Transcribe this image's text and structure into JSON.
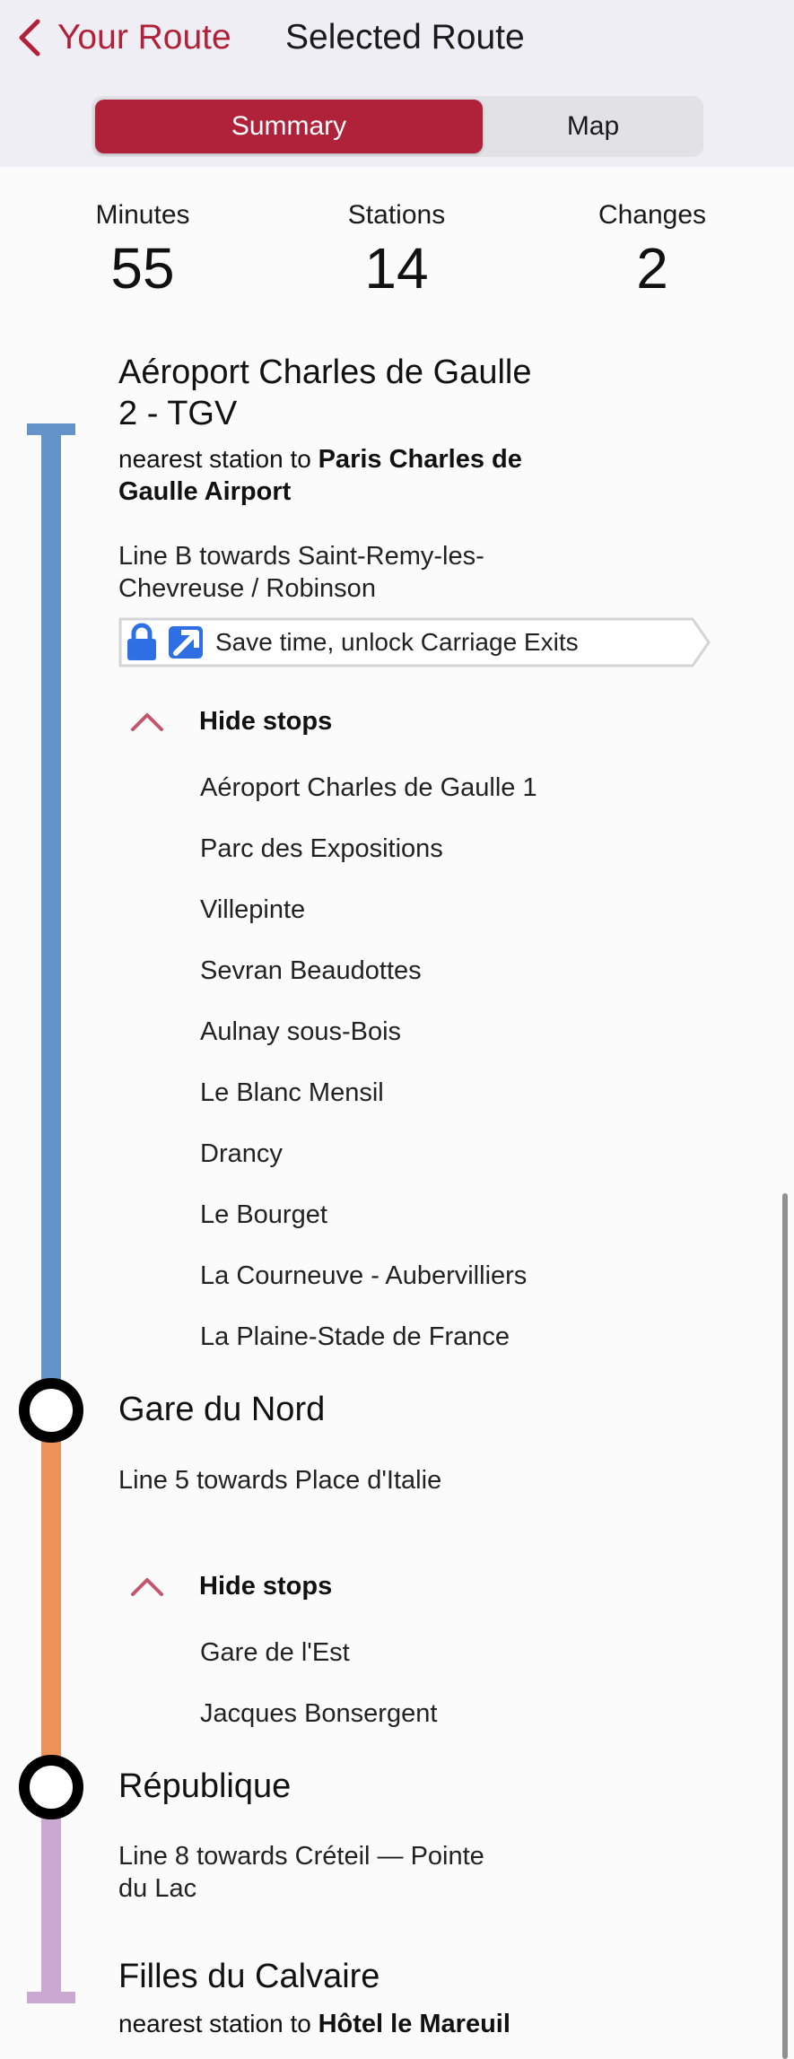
{
  "nav": {
    "back_label": "Your Route",
    "title": "Selected Route"
  },
  "tabs": {
    "summary": "Summary",
    "map": "Map",
    "selected": "Summary"
  },
  "stats": [
    {
      "label": "Minutes",
      "value": "55"
    },
    {
      "label": "Stations",
      "value": "14"
    },
    {
      "label": "Changes",
      "value": "2"
    }
  ],
  "colors": {
    "accent": "#b0213a",
    "line_b": "#6393c9",
    "line_5": "#ea9258",
    "line_8": "#c9a8d2"
  },
  "origin": {
    "name_line1": "Aéroport Charles de Gaulle",
    "name_line2": "2 - TGV",
    "nearest_prefix": "nearest station to",
    "nearest_line1": "Paris Charles de",
    "nearest_line2": "Gaulle Airport",
    "line_info_line1": "Line B towards Saint-Remy-les-",
    "line_info_line2": "Chevreuse / Robinson",
    "promo_text": "Save time, unlock Carriage Exits",
    "promo_icons": [
      "lock-icon",
      "arrow-up-right-icon"
    ],
    "hide_stops_label": "Hide stops",
    "stops": [
      "Aéroport Charles de Gaulle 1",
      "Parc des Expositions",
      "Villepinte",
      "Sevran Beaudottes",
      "Aulnay sous-Bois",
      "Le Blanc Mensil",
      "Drancy",
      "Le Bourget",
      "La Courneuve - Aubervilliers",
      "La Plaine-Stade de France"
    ]
  },
  "change1": {
    "name": "Gare du Nord",
    "line_info": "Line 5 towards Place d'Italie",
    "hide_stops_label": "Hide stops",
    "stops": [
      "Gare de l'Est",
      "Jacques Bonsergent"
    ]
  },
  "change2": {
    "name": "République",
    "line_info_line1": "Line 8 towards Créteil — Pointe",
    "line_info_line2": "du Lac"
  },
  "destination": {
    "name": "Filles du Calvaire",
    "nearest_prefix": "nearest station to",
    "nearest": "Hôtel le Mareuil"
  }
}
